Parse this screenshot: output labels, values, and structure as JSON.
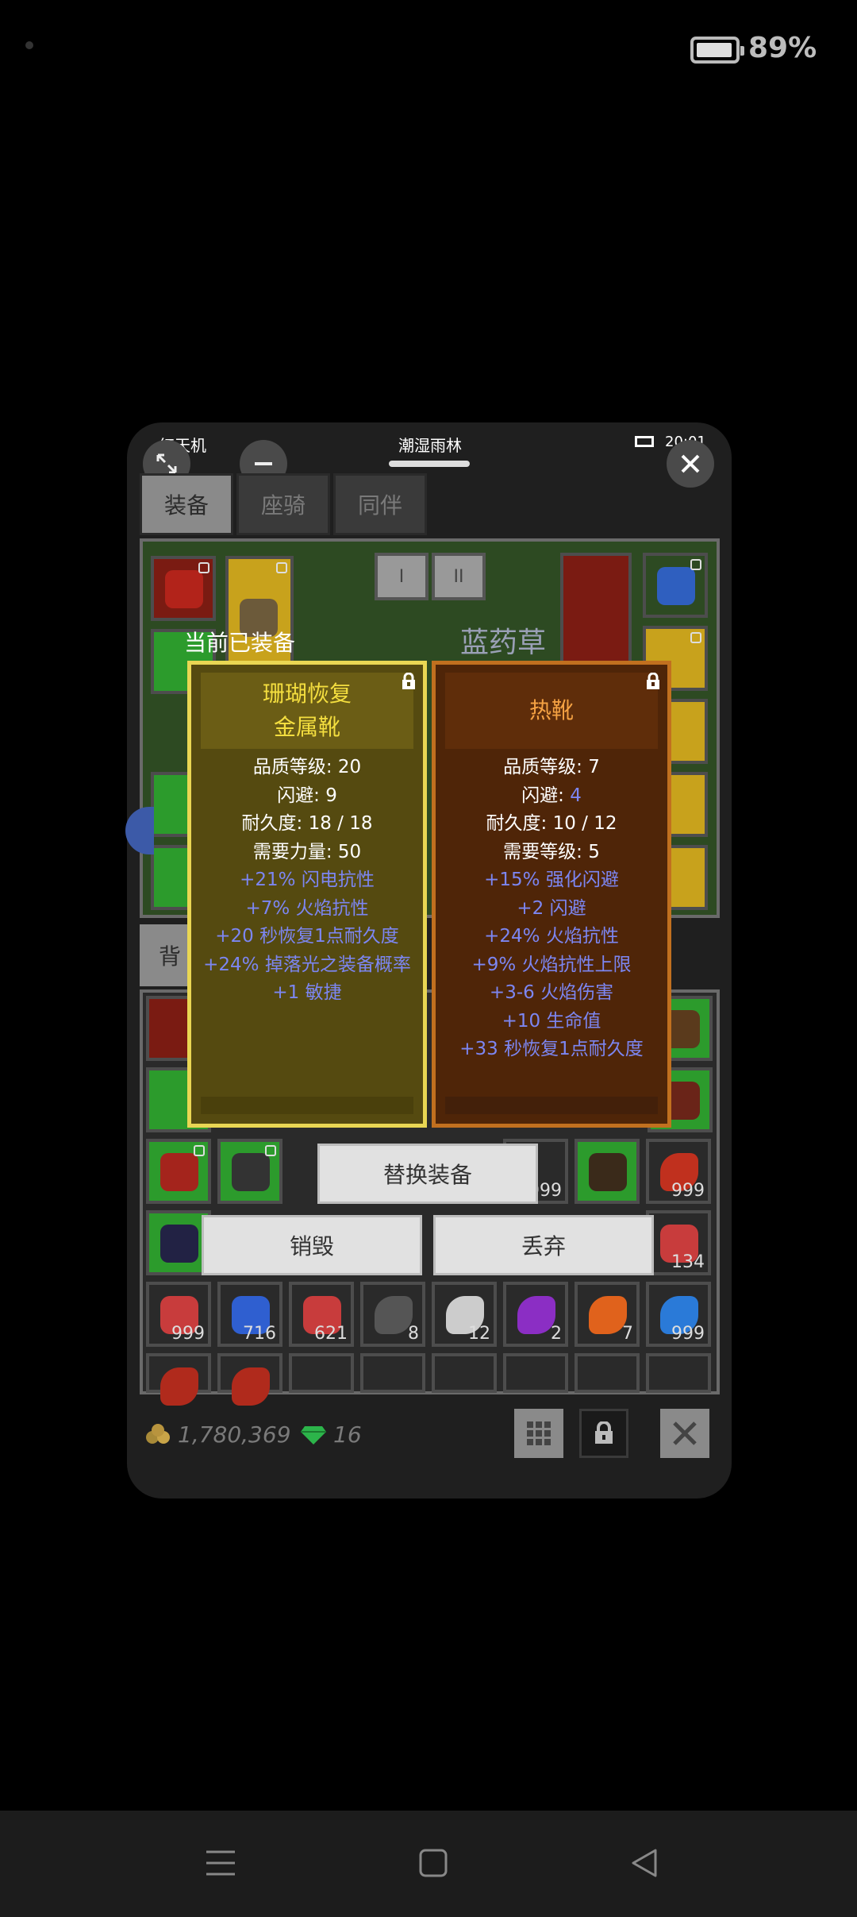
{
  "status_bar": {
    "battery_percent": "89%"
  },
  "window": {
    "app_name": "红天机",
    "location": "潮湿雨林",
    "time": "20:01"
  },
  "tabs": [
    {
      "label": "装备",
      "active": true
    },
    {
      "label": "座骑",
      "active": false
    },
    {
      "label": "同伴",
      "active": false
    }
  ],
  "pager": {
    "page1": "I",
    "page2": "II"
  },
  "herb_label": "蓝药草",
  "current_equipped_label": "当前已装备",
  "equipped_item": {
    "name_line1": "珊瑚恢复",
    "name_line2": "金属靴",
    "stats": [
      {
        "text": "品质等级: 20",
        "type": "white"
      },
      {
        "text": "闪避: 9",
        "type": "white"
      },
      {
        "text": "耐久度: 18 / 18",
        "type": "white"
      },
      {
        "text": "需要力量: 50",
        "type": "white"
      },
      {
        "text": "+21% 闪电抗性",
        "type": "blue"
      },
      {
        "text": "+7% 火焰抗性",
        "type": "blue"
      },
      {
        "text": "+20 秒恢复1点耐久度",
        "type": "blue"
      },
      {
        "text": "+24% 掉落光之装备概率",
        "type": "blue"
      },
      {
        "text": "+1 敏捷",
        "type": "blue"
      }
    ]
  },
  "new_item": {
    "name": "热靴",
    "stats": [
      {
        "text": "品质等级: 7",
        "type": "white"
      },
      {
        "label": "闪避: ",
        "value": "4",
        "type": "mixed"
      },
      {
        "text": "耐久度: 10 / 12",
        "type": "white"
      },
      {
        "text": "需要等级: 5",
        "type": "white"
      },
      {
        "text": "+15% 强化闪避",
        "type": "blue"
      },
      {
        "text": "+2 闪避",
        "type": "blue"
      },
      {
        "text": "+24% 火焰抗性",
        "type": "blue"
      },
      {
        "text": "+9% 火焰抗性上限",
        "type": "blue"
      },
      {
        "text": "+3-6 火焰伤害",
        "type": "blue"
      },
      {
        "text": "+10 生命值",
        "type": "blue"
      },
      {
        "text": "+33 秒恢复1点耐久度",
        "type": "blue"
      }
    ]
  },
  "bag_tab_label": "背",
  "buttons": {
    "replace": "替换装备",
    "destroy": "销毁",
    "discard": "丢弃"
  },
  "bag_counts": {
    "row3_c6": "999",
    "row3_c8": "999",
    "row4_c8": "134",
    "row5": [
      "999",
      "716",
      "621",
      "8",
      "12",
      "2",
      "7",
      "999"
    ]
  },
  "currency": {
    "gold": "1,780,369",
    "gems": "16"
  },
  "colors": {
    "accent_blue": "#7c86f2",
    "gold_name": "#f4de3f",
    "orange_name": "#f5a243"
  }
}
